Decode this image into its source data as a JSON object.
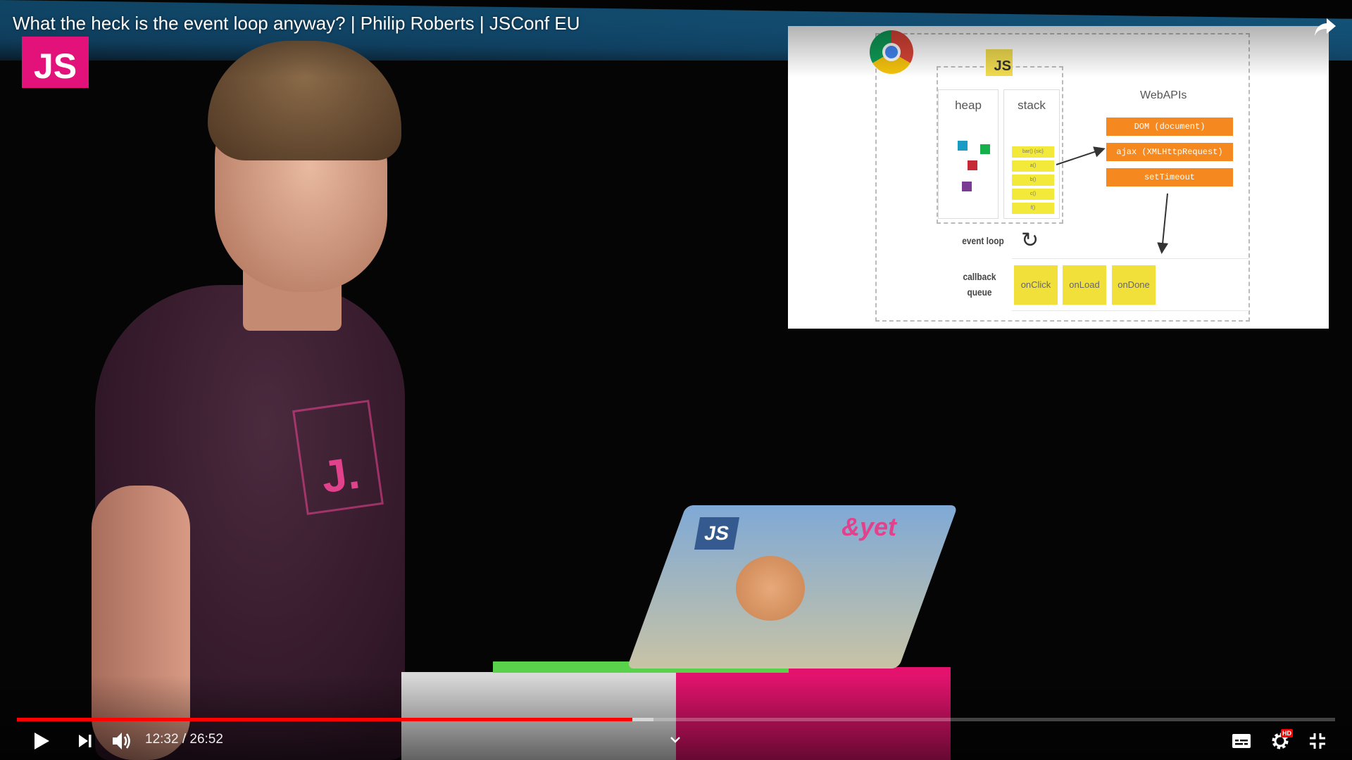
{
  "video": {
    "title": "What the heck is the event loop anyway? | Philip Roberts | JSConf EU",
    "channel_logo_text": "JS",
    "laptop_sticker_js": "JS",
    "laptop_sticker_yet": "&yet",
    "shirt_logo_text": "J."
  },
  "slide": {
    "heap_label": "heap",
    "stack_label": "stack",
    "webapis_label": "WebAPIs",
    "webapis": [
      "DOM (document)",
      "ajax (XMLHttpRequest)",
      "setTimeout"
    ],
    "stack_frames": [
      "bar() {sic}",
      "a()",
      "b()",
      "c()",
      "f()"
    ],
    "event_loop_label": "event loop",
    "callback_queue_label_line1": "callback",
    "callback_queue_label_line2": "queue",
    "callbacks": [
      "onClick",
      "onLoad",
      "onDone"
    ],
    "js_badge": "JS"
  },
  "player": {
    "current_time": "12:32",
    "separator": " / ",
    "duration": "26:52",
    "progress_played_fraction": 0.467,
    "progress_buffered_fraction": 0.483,
    "hd_badge": "HD",
    "progress_color": "#ff0000"
  },
  "icons": {
    "share": "share-icon",
    "play": "play-icon",
    "next": "next-icon",
    "volume": "volume-icon",
    "chevron": "chevron-down-icon",
    "captions": "captions-icon",
    "settings": "gear-icon",
    "fullscreen_exit": "fullscreen-exit-icon"
  },
  "colors": {
    "channel_brand": "#e2127a",
    "webapi_orange": "#f5891f",
    "callback_yellow": "#f2e03a"
  }
}
